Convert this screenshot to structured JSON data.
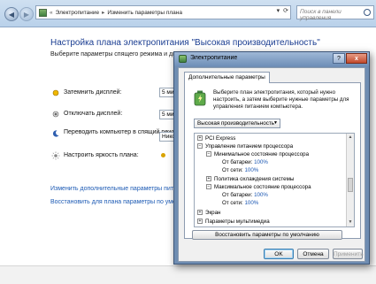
{
  "address_bar": {
    "crumb1": "Электропитание",
    "crumb2": "Изменить параметры плана"
  },
  "search": {
    "placeholder": "Поиск в панели управления"
  },
  "main": {
    "title": "Настройка плана электропитания \"Высокая производительность\"",
    "subtitle": "Выберите параметры спящего режима и дисплея",
    "settings": [
      {
        "label": "Затемнить дисплей:",
        "value": "5 мин"
      },
      {
        "label": "Отключать дисплей:",
        "value": "5 мин"
      },
      {
        "label": "Переводить компьютер в спящий режим:",
        "value": "Нико"
      },
      {
        "label": "Настроить яркость плана:"
      }
    ],
    "links": [
      "Изменить дополнительные параметры питания",
      "Восстановить для плана параметры по умолча"
    ]
  },
  "dialog": {
    "title": "Электропитание",
    "help": "?",
    "close": "x",
    "tab": "Дополнительные параметры",
    "info": "Выберите план электропитания, который нужно настроить, а затем выберите нужные параметры для управления питанием компьютера.",
    "plan": "Высокая производительность",
    "tree": {
      "item1": "PCI Express",
      "item2": "Управление питанием процессора",
      "item3": "Минимальное состояние процессора",
      "battery_label": "От батареи:",
      "battery_val1": "100%",
      "ac_label": "От сети:",
      "ac_val1": "100%",
      "item4": "Политика охлаждения системы",
      "item5": "Максимальное состояние процессора",
      "battery_val2": "100%",
      "ac_val2": "100%",
      "item6": "Экран",
      "item7": "Параметры мультимедиа"
    },
    "restore_button": "Восстановить параметры по умолчанию",
    "ok": "OK",
    "cancel": "Отмена",
    "apply": "Применить"
  }
}
